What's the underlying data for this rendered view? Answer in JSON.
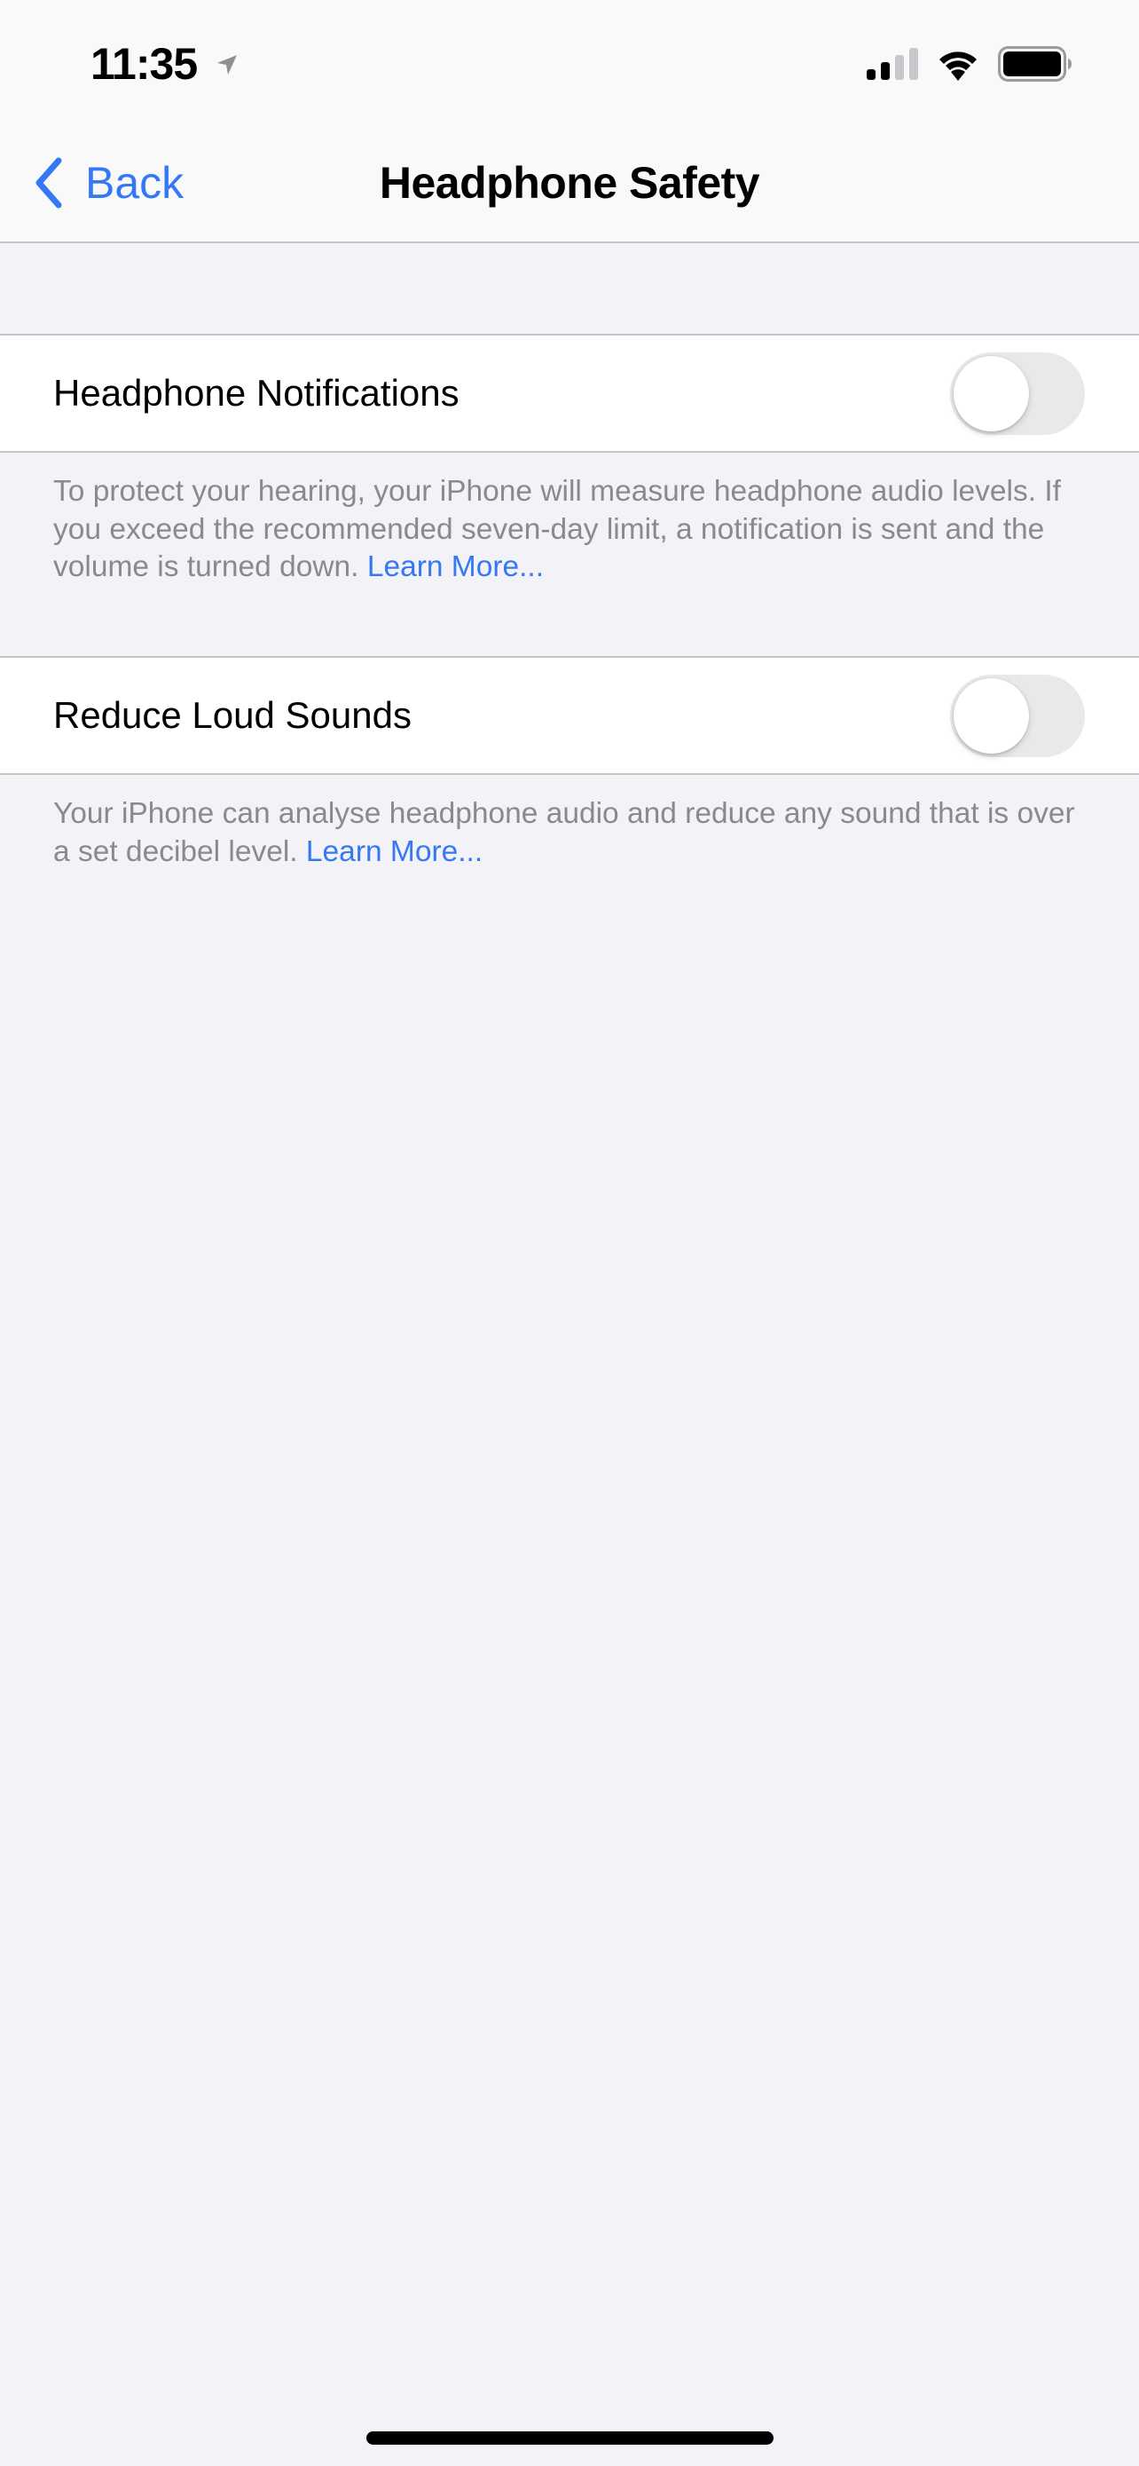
{
  "status_bar": {
    "time": "11:35",
    "location_icon": "location-arrow-icon",
    "signal_icon": "cellular-signal-icon",
    "signal_bars_active": 2,
    "signal_bars_total": 4,
    "wifi_icon": "wifi-icon",
    "battery_icon": "battery-icon",
    "battery_level": 1.0
  },
  "nav": {
    "back_label": "Back",
    "back_icon": "chevron-left-icon",
    "title": "Headphone Safety"
  },
  "sections": [
    {
      "label": "Headphone Notifications",
      "toggle_on": false,
      "footer": "To protect your hearing, your iPhone will measure headphone audio levels. If you exceed the recommended seven-day limit, a notification is sent and the volume is turned down.",
      "footer_link": "Learn More..."
    },
    {
      "label": "Reduce Loud Sounds",
      "toggle_on": false,
      "footer": "Your iPhone can analyse headphone audio and reduce any sound that is over a set decibel level.",
      "footer_link": "Learn More..."
    }
  ],
  "colors": {
    "accent": "#3478f6",
    "background": "#f2f2f7",
    "cell_background": "#ffffff",
    "secondary_text": "#8a8a8e",
    "toggle_off_track": "#e9e9eb",
    "separator": "#c6c6c8"
  }
}
